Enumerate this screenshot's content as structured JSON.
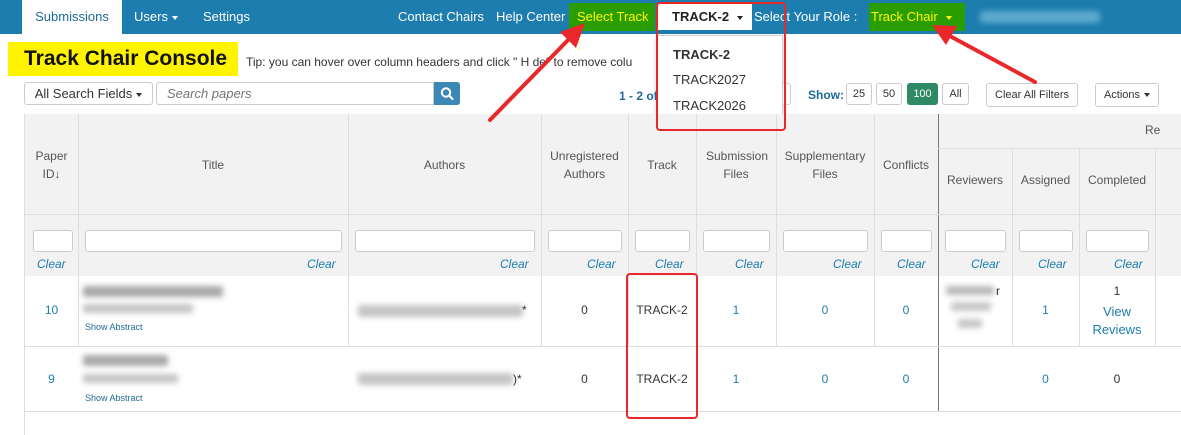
{
  "nav": {
    "submissions": "Submissions",
    "users": "Users",
    "settings": "Settings",
    "contact_chairs": "Contact Chairs",
    "help_center": "Help Center",
    "select_track_label": "Select Track :",
    "selected_track": "TRACK-2",
    "select_role_label": "Select Your Role :",
    "selected_role": "Track Chair"
  },
  "track_dropdown": {
    "options": [
      "TRACK-2",
      "TRACK2027",
      "TRACK2026"
    ]
  },
  "console": {
    "title": "Track Chair Console",
    "tip": "Tip: you can hover over column headers and click \" H de\" to remove colu"
  },
  "toolbar": {
    "search_field": "All Search Fields",
    "search_placeholder": "Search papers",
    "pagination": "1 - 2 of",
    "show_label": "Show:",
    "show_options": [
      "25",
      "50",
      "100",
      "All"
    ],
    "show_selected": "100",
    "clear_filters": "Clear All Filters",
    "actions": "Actions"
  },
  "table": {
    "headers": {
      "paper_id": "Paper ID",
      "sort_arrow": "↓",
      "title": "Title",
      "authors": "Authors",
      "unregistered_authors": "Unregistered Authors",
      "track": "Track",
      "submission_files": "Submission Files",
      "supplementary_files": "Supplementary Files",
      "conflicts": "Conflicts",
      "review_group": "Re",
      "reviewers": "Reviewers",
      "assigned": "Assigned",
      "completed": "Completed"
    },
    "clear_label": "Clear",
    "rows": [
      {
        "id": "10",
        "authors_suffix": "*",
        "unregistered": "0",
        "track": "TRACK-2",
        "submission_files": "1",
        "supplementary_files": "0",
        "conflicts": "0",
        "reviewers_suffix": "r",
        "assigned": "1",
        "completed": "1",
        "view_reviews": "View Reviews",
        "show_abstract": "Show Abstract"
      },
      {
        "id": "9",
        "authors_suffix": ")*",
        "unregistered": "0",
        "track": "TRACK-2",
        "submission_files": "1",
        "supplementary_files": "0",
        "conflicts": "0",
        "reviewers_suffix": "",
        "assigned": "0",
        "completed": "0",
        "view_reviews": "",
        "show_abstract": "Show Abstract"
      }
    ]
  },
  "colors": {
    "navbar": "#1c7dae",
    "highlight_green": "#2a9d00",
    "highlight_text": "#fff500",
    "title_highlight": "#fff300",
    "annotation_red": "#e8282b",
    "link": "#1c7dae"
  }
}
